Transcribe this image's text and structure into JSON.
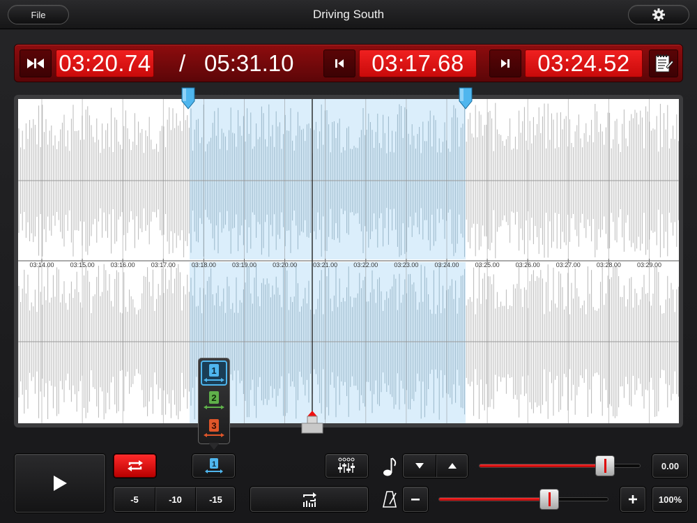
{
  "titlebar": {
    "file_label": "File",
    "title": "Driving South",
    "settings_icon": "gear-icon"
  },
  "time": {
    "current": "03:20.74",
    "separator": "/",
    "total": "05:31.10",
    "loop_start": "03:17.68",
    "loop_end": "03:24.52"
  },
  "waveform": {
    "time_labels": [
      "03:14.00",
      "03:15.00",
      "03:16.00",
      "03:17.00",
      "03:18.00",
      "03:19.00",
      "03:20.00",
      "03:21.00",
      "03:22.00",
      "03:23.00",
      "03:24.00",
      "03:25.00",
      "03:26.00",
      "03:27.00",
      "03:28.00",
      "03:29.00"
    ],
    "colors": {
      "selection": "#dbeefb",
      "wave": "#b8b8b8",
      "selected_wave": "#9ab7c9"
    }
  },
  "controls": {
    "skip_back": [
      "-5",
      "-10",
      "-15"
    ],
    "pitch_value": "0.00",
    "tempo_value": "100%",
    "loop_slots": [
      "1",
      "2",
      "3"
    ],
    "pitch_level": 0.78,
    "tempo_level": 0.65
  },
  "colors": {
    "accent_red": "#e51616",
    "panel_red": "#8e0c0e",
    "marker_blue": "#4fb6ee"
  }
}
